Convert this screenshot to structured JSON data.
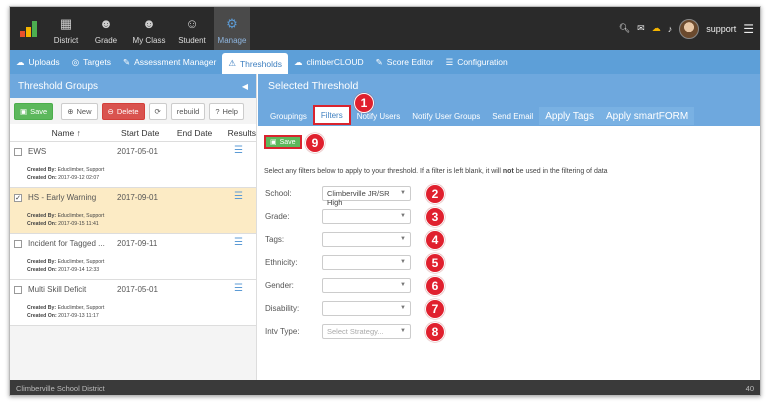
{
  "nav": {
    "items": [
      {
        "label": "District",
        "icon": "building-icon"
      },
      {
        "label": "Grade",
        "icon": "group-icon"
      },
      {
        "label": "My Class",
        "icon": "class-icon"
      },
      {
        "label": "Student",
        "icon": "student-icon"
      },
      {
        "label": "Manage",
        "icon": "gears-icon"
      }
    ],
    "user": "support"
  },
  "tabs": [
    "Uploads",
    "Targets",
    "Assessment Manager",
    "Thresholds",
    "climberCLOUD",
    "Score Editor",
    "Configuration"
  ],
  "left": {
    "title": "Threshold Groups",
    "toolbar": {
      "save": "Save",
      "new": "New",
      "delete": "Delete",
      "rebuild": "rebuild",
      "help": "Help"
    },
    "columns": {
      "name": "Name",
      "start": "Start Date",
      "end": "End Date",
      "results": "Results"
    },
    "rows": [
      {
        "name": "EWS",
        "start": "2017-05-01",
        "created_by_label": "Created By:",
        "created_by": "Educlimber, Support",
        "created_on_label": "Created On:",
        "created_on": "2017-09-12 02:07"
      },
      {
        "name": "HS - Early Warning",
        "start": "2017-09-01",
        "created_by_label": "Created By:",
        "created_by": "Educlimber, Support",
        "created_on_label": "Created On:",
        "created_on": "2017-09-15 11:41"
      },
      {
        "name": "Incident for Tagged ...",
        "start": "2017-09-11",
        "created_by_label": "Created By:",
        "created_by": "Educlimber, Support",
        "created_on_label": "Created On:",
        "created_on": "2017-09-14 12:33"
      },
      {
        "name": "Multi Skill Deficit",
        "start": "2017-05-01",
        "created_by_label": "Created By:",
        "created_by": "Educlimber, Support",
        "created_on_label": "Created On:",
        "created_on": "2017-09-13 11:17"
      }
    ]
  },
  "right": {
    "title": "Selected Threshold",
    "subtabs": [
      "Groupings",
      "Filters",
      "Notify Users",
      "Notify User Groups",
      "Send Email",
      "Apply Tags",
      "Apply smartFORM"
    ],
    "save": "Save",
    "instruction_pre": "Select any filters below to apply to your threshold. If a filter is left blank, it will ",
    "instruction_bold": "not",
    "instruction_post": " be used in the filtering of data",
    "filters": [
      {
        "label": "School:",
        "value": "Climberville JR/SR High"
      },
      {
        "label": "Grade:",
        "value": ""
      },
      {
        "label": "Tags:",
        "value": ""
      },
      {
        "label": "Ethnicity:",
        "value": ""
      },
      {
        "label": "Gender:",
        "value": ""
      },
      {
        "label": "Disability:",
        "value": ""
      },
      {
        "label": "Intv Type:",
        "value": "Select Strategy..."
      }
    ]
  },
  "badges": [
    "1",
    "2",
    "3",
    "4",
    "5",
    "6",
    "7",
    "8",
    "9"
  ],
  "footer": {
    "district": "Climberville School District",
    "version": "40"
  },
  "colors": {
    "accent": "#5d9fd8",
    "badge": "#e0202e",
    "selected_row": "#fcebc5"
  }
}
